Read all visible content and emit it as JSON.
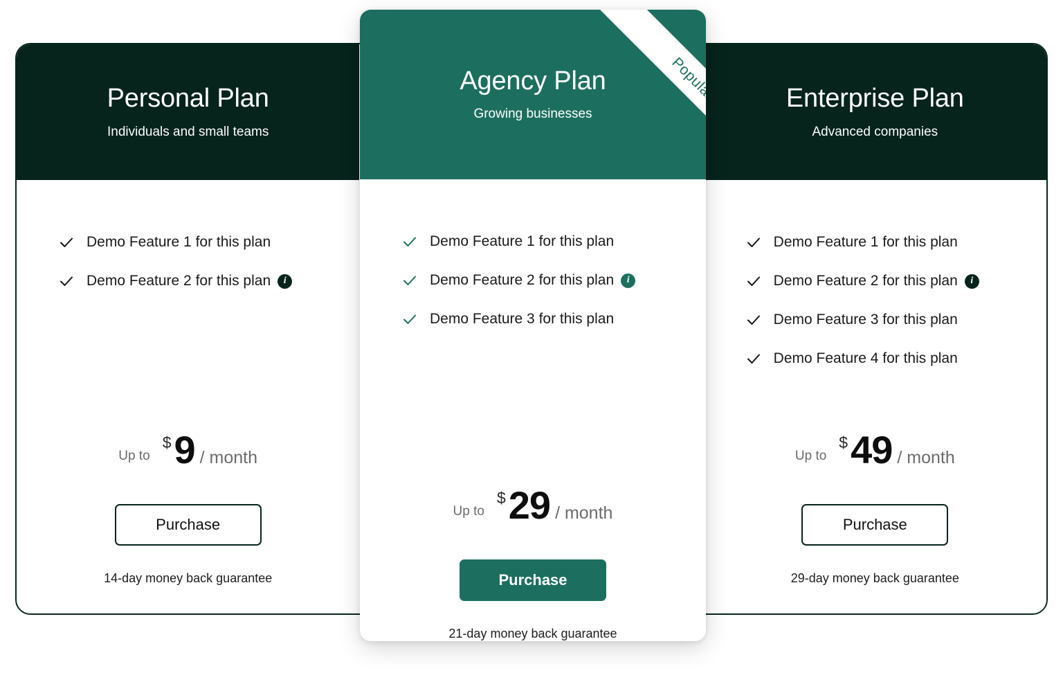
{
  "accent_color": "#1C6F5F",
  "dark_color": "#06231C",
  "plans": [
    {
      "id": "personal",
      "title": "Personal Plan",
      "subtitle": "Individuals and small teams",
      "features": [
        {
          "label": "Demo Feature 1 for this plan",
          "info": false
        },
        {
          "label": "Demo Feature 2 for this plan",
          "info": true
        }
      ],
      "price": {
        "upto": "Up to",
        "currency": "$",
        "amount": "9",
        "period": "/ month"
      },
      "cta": "Purchase",
      "guarantee": "14-day money back guarantee",
      "featured": false,
      "badge": null
    },
    {
      "id": "agency",
      "title": "Agency Plan",
      "subtitle": "Growing businesses",
      "features": [
        {
          "label": "Demo Feature 1 for this plan",
          "info": false
        },
        {
          "label": "Demo Feature 2 for this plan",
          "info": true
        },
        {
          "label": "Demo Feature 3 for this plan",
          "info": false
        }
      ],
      "price": {
        "upto": "Up to",
        "currency": "$",
        "amount": "29",
        "period": "/ month"
      },
      "cta": "Purchase",
      "guarantee": "21-day money back guarantee",
      "featured": true,
      "badge": "Popular"
    },
    {
      "id": "enterprise",
      "title": "Enterprise Plan",
      "subtitle": "Advanced companies",
      "features": [
        {
          "label": "Demo Feature 1 for this plan",
          "info": false
        },
        {
          "label": "Demo Feature 2 for this plan",
          "info": true
        },
        {
          "label": "Demo Feature 3 for this plan",
          "info": false
        },
        {
          "label": "Demo Feature 4 for this plan",
          "info": false
        }
      ],
      "price": {
        "upto": "Up to",
        "currency": "$",
        "amount": "49",
        "period": "/ month"
      },
      "cta": "Purchase",
      "guarantee": "29-day money back guarantee",
      "featured": false,
      "badge": null
    }
  ],
  "icons": {
    "check": "check-icon",
    "info": "info-icon"
  },
  "info_glyph": "i"
}
